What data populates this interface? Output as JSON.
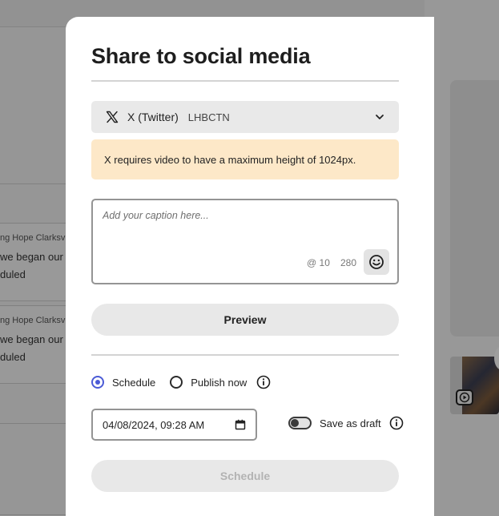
{
  "background": {
    "posts": [
      {
        "org": "ng Hope Clarksvil",
        "line1": "we began our",
        "line2": "duled"
      },
      {
        "org": "ng Hope Clarksvil",
        "line1": "we began our",
        "line2": "duled"
      }
    ]
  },
  "modal": {
    "title": "Share to social media",
    "account": {
      "platform": "X (Twitter)",
      "handle": "LHBCTN",
      "icon": "x-logo-icon"
    },
    "alert": "X requires video to have a maximum height of 1024px.",
    "caption": {
      "placeholder": "Add your caption here...",
      "value": "",
      "mentions_remaining": "10",
      "mentions_label": "@ 10",
      "chars_remaining": "280"
    },
    "preview_label": "Preview",
    "publish": {
      "schedule_label": "Schedule",
      "publish_now_label": "Publish now",
      "selected": "schedule"
    },
    "datetime": "04/08/2024, 09:28 AM",
    "save_as_draft_label": "Save as draft",
    "save_as_draft_checked": false,
    "schedule_button_label": "Schedule",
    "schedule_button_enabled": false
  },
  "colors": {
    "accent": "#4b5bd6",
    "alert_bg": "#fde8c8"
  }
}
